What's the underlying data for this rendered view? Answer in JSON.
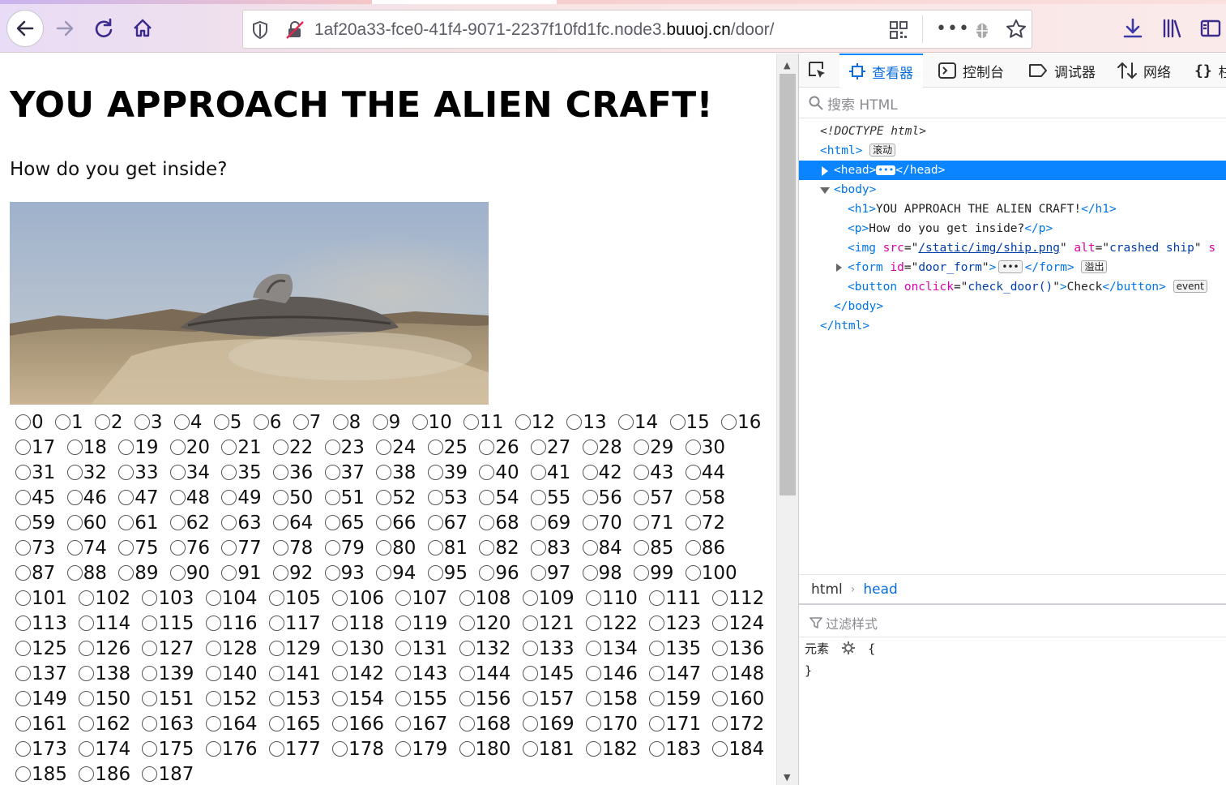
{
  "browser": {
    "url_prefix": "1af20a33-fce0-41f4-9071-2237f10fd1fc.node3.",
    "url_domain": "buuoj.cn",
    "url_path": "/door/"
  },
  "page": {
    "heading": "YOU APPROACH THE ALIEN CRAFT!",
    "subheading": "How do you get inside?",
    "image_alt": "crashed ship",
    "radio_count": 188
  },
  "devtools": {
    "tabs": [
      "查看器",
      "控制台",
      "调试器",
      "网络",
      "柱"
    ],
    "search_placeholder": "搜索 HTML",
    "tree": {
      "doctype": "<!DOCTYPE html>",
      "html_open": "<html>",
      "scroll_badge": "滚动",
      "head_open": "<head>",
      "head_close": "</head>",
      "body_open": "<body>",
      "h1_open": "<h1>",
      "h1_text": "YOU APPROACH THE ALIEN CRAFT!",
      "h1_close": "</h1>",
      "p_open": "<p>",
      "p_text": "How do you get inside?",
      "p_close": "</p>",
      "img_tag": "<img",
      "img_src_attr": "src",
      "img_src": "/static/img/ship.png",
      "img_alt_attr": "alt",
      "img_alt": "crashed ship",
      "img_tail": "s",
      "form_tag": "<form",
      "form_id_attr": "id",
      "form_id": "door_form",
      "form_close": "</form>",
      "overflow_badge": "溢出",
      "button_tag": "<button",
      "button_attr": "onclick",
      "button_attr_val": "check_door()",
      "button_text": "Check",
      "button_close": "</button>",
      "event_badge": "event",
      "body_close": "</body>",
      "html_close": "</html>"
    },
    "breadcrumb": [
      "html",
      "head"
    ],
    "filter_placeholder": "过滤样式",
    "rule_selector": "元素",
    "rule_open": "{",
    "rule_close": "}"
  }
}
